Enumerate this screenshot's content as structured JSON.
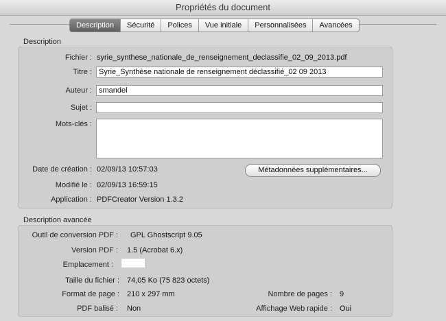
{
  "window": {
    "title": "Propriétés du document"
  },
  "tabs": [
    {
      "label": "Description"
    },
    {
      "label": "Sécurité"
    },
    {
      "label": "Polices"
    },
    {
      "label": "Vue initiale"
    },
    {
      "label": "Personnalisées"
    },
    {
      "label": "Avancées"
    }
  ],
  "description": {
    "section_title": "Description",
    "fichier_label": "Fichier :",
    "fichier_value": "syrie_synthese_nationale_de_renseignement_declassifie_02_09_2013.pdf",
    "titre_label": "Titre :",
    "titre_value": "Syrie_Synthèse nationale de renseignement déclassifié_02 09 2013",
    "auteur_label": "Auteur :",
    "auteur_value": "smandel",
    "sujet_label": "Sujet :",
    "sujet_value": "",
    "motscles_label": "Mots-clés :",
    "motscles_value": "",
    "creation_label": "Date de création :",
    "creation_value": "02/09/13 10:57:03",
    "modifie_label": "Modifié le :",
    "modifie_value": "02/09/13 16:59:15",
    "application_label": "Application :",
    "application_value": "PDFCreator Version 1.3.2",
    "metadata_button": "Métadonnées supplémentaires..."
  },
  "advanced": {
    "section_title": "Description avancée",
    "outil_label": "Outil de conversion PDF :",
    "outil_value": "GPL Ghostscript 9.05",
    "version_label": "Version PDF :",
    "version_value": "1.5 (Acrobat 6.x)",
    "emplacement_label": "Emplacement :",
    "emplacement_value": "",
    "taille_label": "Taille du fichier :",
    "taille_value": "74,05 Ko (75 823 octets)",
    "format_label": "Format de page :",
    "format_value": "210 x 297 mm",
    "balise_label": "PDF balisé :",
    "balise_value": "Non",
    "pages_label": "Nombre de pages :",
    "pages_value": "9",
    "web_label": "Affichage Web rapide :",
    "web_value": "Oui"
  }
}
